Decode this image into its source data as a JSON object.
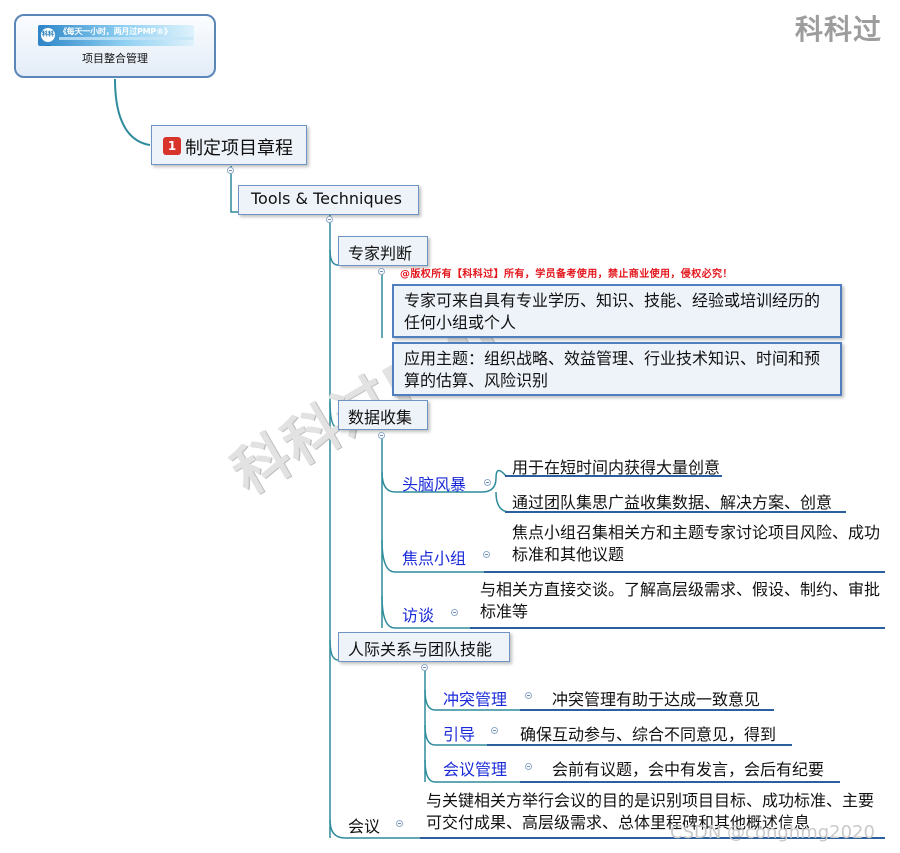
{
  "brand": "科科过",
  "watermark": "科科过PMP",
  "credit": "CSDN @conghmg2020",
  "copyright": "@版权所有【科科过】所有，学员备考使用，禁止商业使用，侵权必究！",
  "root": {
    "banner_logo": "科科过",
    "banner_text": "《每天一小时，两月过PMP®》",
    "label": "项目整合管理"
  },
  "central": {
    "badge": "1",
    "label": "制定项目章程"
  },
  "tools": {
    "label": "Tools & Techniques"
  },
  "expert": {
    "label": "专家判断",
    "desc1": "专家可来自具有专业学历、知识、技能、经验或培训经历的任何小组或个人",
    "desc2": "应用主题：组织战略、效益管理、行业技术知识、时间和预算的估算、风险识别"
  },
  "data_collection": {
    "label": "数据收集",
    "brainstorm": {
      "label": "头脑风暴",
      "item1": "用于在短时间内获得大量创意",
      "item2": "通过团队集思广益收集数据、解决方案、创意"
    },
    "focus_group": {
      "label": "焦点小组",
      "desc": "焦点小组召集相关方和主题专家讨论项目风险、成功标准和其他议题"
    },
    "interview": {
      "label": "访谈",
      "desc": "与相关方直接交谈。了解高层级需求、假设、制约、审批标准等"
    }
  },
  "interpersonal": {
    "label": "人际关系与团队技能",
    "conflict": {
      "label": "冲突管理",
      "desc": "冲突管理有助于达成一致意见"
    },
    "facilitation": {
      "label": "引导",
      "desc": "确保互动参与、综合不同意见，得到"
    },
    "meeting_mgmt": {
      "label": "会议管理",
      "desc": "会前有议题，会中有发言，会后有纪要"
    }
  },
  "meetings": {
    "label": "会议",
    "desc": "与关键相关方举行会议的目的是识别项目目标、成功标准、主要可交付成果、高层级需求、总体里程碑和其他概述信息"
  }
}
